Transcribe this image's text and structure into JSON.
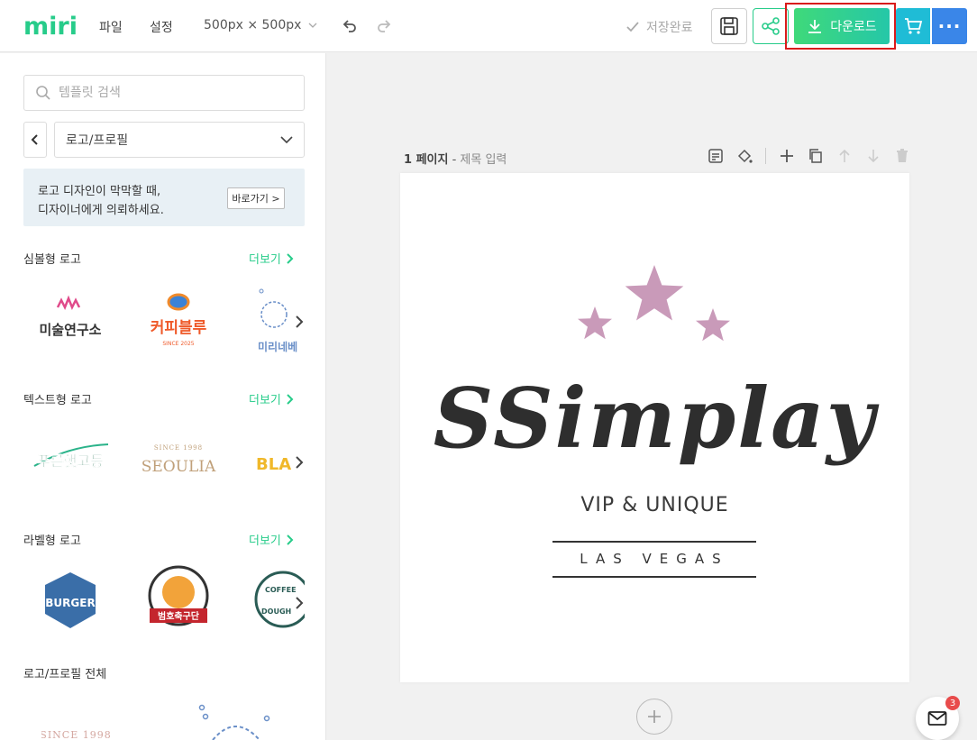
{
  "app": {
    "logo": "miri"
  },
  "topbar": {
    "menu_file": "파일",
    "menu_settings": "설정",
    "canvas_size": "500px × 500px",
    "save_status": "저장완료",
    "download_label": "다운로드",
    "more_label": "···"
  },
  "sidebar": {
    "search_placeholder": "템플릿 검색",
    "category": "로고/프로필",
    "banner": {
      "line1": "로고 디자인이 막막할 때,",
      "line2": "디자이너에게 의뢰하세요.",
      "button": "바로가기 >"
    },
    "sections": [
      {
        "title": "심볼형 로고",
        "more": "더보기"
      },
      {
        "title": "텍스트형 로고",
        "more": "더보기"
      },
      {
        "title": "라벨형 로고",
        "more": "더보기"
      },
      {
        "title": "로고/프로필 전체"
      }
    ],
    "thumb_text": {
      "t1": "미술연구소",
      "t2": "커피블루",
      "t2_sub": "SINCE 2025",
      "t3": "미리네베",
      "t4": "푸른햇고등",
      "t5_top": "SINCE 1998",
      "t5": "SEOULIA",
      "t6": "BLA",
      "t7": "BURGER",
      "t8": "범호축구단",
      "t9a": "COFFEE",
      "t9b": "DOUGH",
      "t10": "SINCE 1998"
    }
  },
  "page": {
    "number": "1 페이지",
    "separator": " - ",
    "title_placeholder": "제목 입력"
  },
  "design": {
    "brand": "SSimplay",
    "tagline": "VIP & UNIQUE",
    "city": "LAS VEGAS",
    "star_color": "#c99ab9"
  },
  "notifications": {
    "count": "3"
  },
  "colors": {
    "accent": "#27cc8a",
    "download_highlight": "#d91b1b",
    "cart": "#1fbcd6",
    "more": "#3a86e8"
  }
}
